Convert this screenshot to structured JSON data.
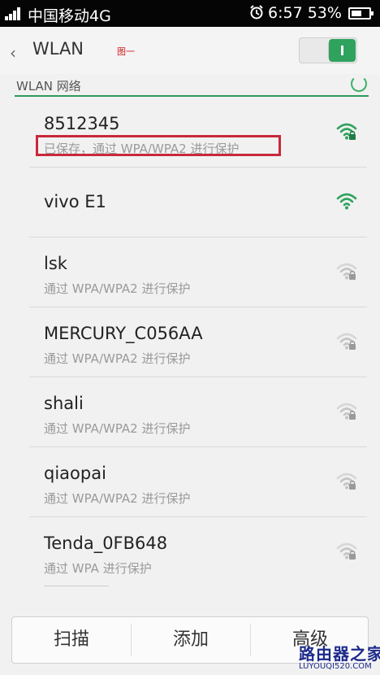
{
  "status_bar": {
    "carrier": "中国移动4G",
    "time": "6:57",
    "battery": "53%"
  },
  "header": {
    "title": "WLAN",
    "annotation": "图一",
    "wifi_enabled": true
  },
  "section": {
    "label": "WLAN 网络"
  },
  "networks": [
    {
      "name": "8512345",
      "desc": "已保存，通过 WPA/WPA2 进行保护",
      "locked": true,
      "signal": "strong",
      "highlighted": true
    },
    {
      "name": "vivo E1",
      "desc": "",
      "locked": false,
      "signal": "strong"
    },
    {
      "name": "lsk",
      "desc": "通过 WPA/WPA2 进行保护",
      "locked": true,
      "signal": "weak"
    },
    {
      "name": "MERCURY_C056AA",
      "desc": "通过 WPA/WPA2 进行保护",
      "locked": true,
      "signal": "weak"
    },
    {
      "name": "shali",
      "desc": "通过 WPA/WPA2 进行保护",
      "locked": true,
      "signal": "weak"
    },
    {
      "name": "qiaopai",
      "desc": "通过 WPA/WPA2 进行保护",
      "locked": true,
      "signal": "weak"
    },
    {
      "name": "Tenda_0FB648",
      "desc": "通过 WPA 进行保护",
      "locked": true,
      "signal": "weak"
    }
  ],
  "bottom_bar": {
    "scan": "扫描",
    "add": "添加",
    "advanced": "高级"
  },
  "watermark": {
    "text": "路由器之家",
    "url": "LUYOUQI520.COM"
  },
  "colors": {
    "accent": "#2fa25e",
    "highlight_box": "#c9283a",
    "status_bar": "#050505"
  }
}
